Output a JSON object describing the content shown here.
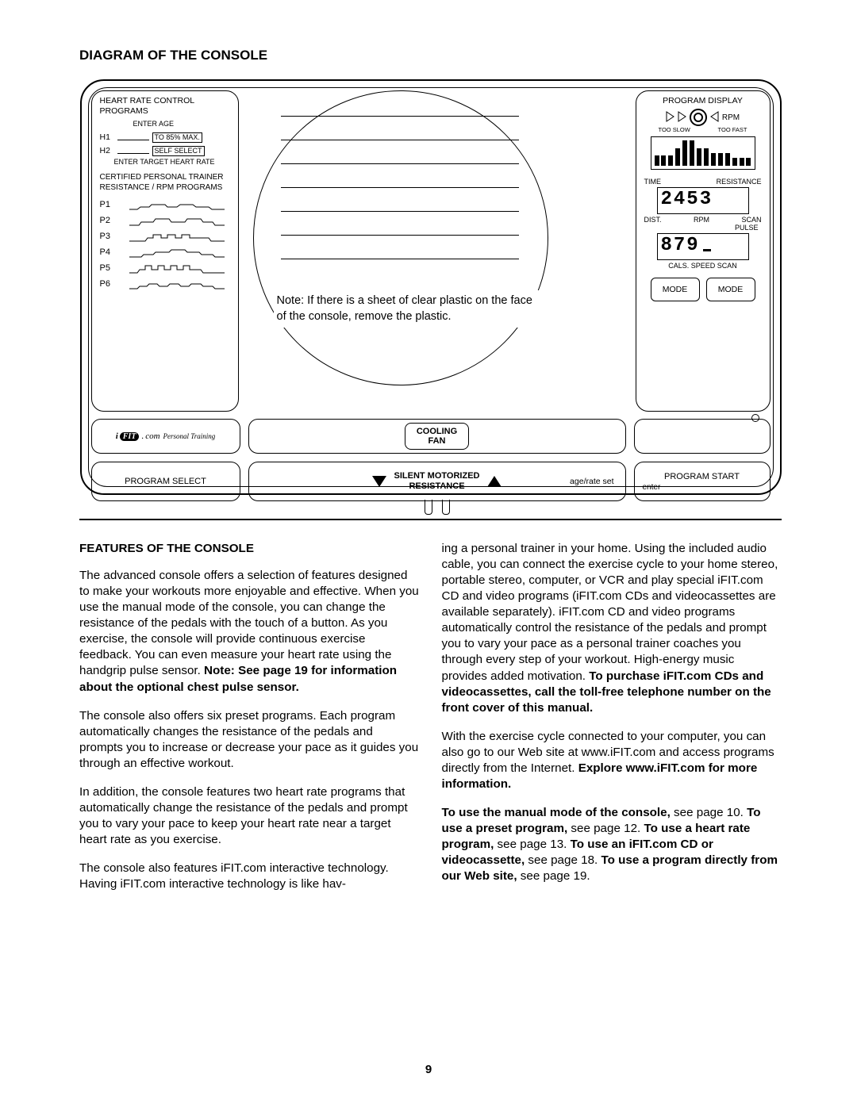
{
  "title": "DIAGRAM OF THE CONSOLE",
  "left_panel": {
    "heading": "HEART RATE CONTROL PROGRAMS",
    "enter_age": "ENTER AGE",
    "h1": "H1",
    "h1_box": "TO 85% MAX.",
    "h2": "H2",
    "h2_box": "SELF SELECT",
    "enter_target": "ENTER TARGET HEART RATE",
    "cpt_heading": "CERTIFIED PERSONAL TRAINER RESISTANCE / RPM PROGRAMS",
    "programs": [
      "P1",
      "P2",
      "P3",
      "P4",
      "P5",
      "P6"
    ]
  },
  "center": {
    "note": "Note: If there is a sheet of clear plastic on the face of the console, remove the plastic."
  },
  "right_panel": {
    "heading": "PROGRAM DISPLAY",
    "rpm": "RPM",
    "too_slow": "TOO SLOW",
    "too_fast": "TOO FAST",
    "time": "TIME",
    "resistance": "RESISTANCE",
    "lcd1": "2453",
    "dist": "DIST.",
    "rpm2": "RPM",
    "scan": "SCAN",
    "pulse": "PULSE",
    "lcd2": "879",
    "cals_speed_scan": "CALS. SPEED SCAN",
    "mode": "MODE"
  },
  "mid_row": {
    "ifit_com": "com",
    "ifit_pt": "Personal Training",
    "cooling_fan": "COOLING\nFAN"
  },
  "bottom_row": {
    "program_select": "PROGRAM SELECT",
    "silent_res": "SILENT MOTORIZED\nRESISTANCE",
    "age_rate": "age/rate set",
    "program_start": "PROGRAM START",
    "enter": "enter"
  },
  "features": {
    "heading": "FEATURES OF THE CONSOLE",
    "p1a": "The advanced console offers a selection of features designed to make your workouts more enjoyable and effective. When you use the manual mode of the console, you can change the resistance of the pedals with the touch of a button. As you exercise, the console will provide continuous exercise feedback. You can even measure your heart rate using the handgrip pulse sensor. ",
    "p1b": "Note: See page 19 for information about the optional chest pulse sensor.",
    "p2": "The console also offers six preset programs. Each program automatically changes the resistance of the pedals and prompts you to increase or decrease your pace as it guides you through an effective workout.",
    "p3": "In addition, the console features two heart rate programs that automatically change the resistance of the pedals and prompt you to vary your pace to keep your heart rate near a target heart rate as you exercise.",
    "p4": "The console also features iFIT.com interactive technology. Having iFIT.com interactive technology is like hav-",
    "r1a": "ing a personal trainer in your home. Using the included audio cable, you can connect the exercise cycle to your home stereo, portable stereo, computer, or VCR and play special iFIT.com CD and video programs (iFIT.com CDs and videocassettes are available separately). iFIT.com CD and video programs automatically control the resistance of the pedals and prompt you to vary your pace as a personal trainer coaches you through every step of your workout. High-energy music provides added motivation. ",
    "r1b": "To purchase iFIT.com CDs and videocassettes, call the toll-free telephone number on the front cover of this manual.",
    "r2a": "With the exercise cycle connected to your computer, you can also go to our Web site at www.iFIT.com and access programs directly from the Internet. ",
    "r2b": "Explore www.iFIT.com for more information.",
    "r3_1b": "To use the manual mode of the console,",
    "r3_1": " see page 10. ",
    "r3_2b": "To use a preset program,",
    "r3_2": " see page 12. ",
    "r3_3b": "To use a heart rate program,",
    "r3_3": " see page 13. ",
    "r3_4b": "To use an iFIT.com CD or videocassette,",
    "r3_4": " see page 18. ",
    "r3_5b": "To use a program directly from our Web site,",
    "r3_5": " see page 19."
  },
  "page_number": "9"
}
